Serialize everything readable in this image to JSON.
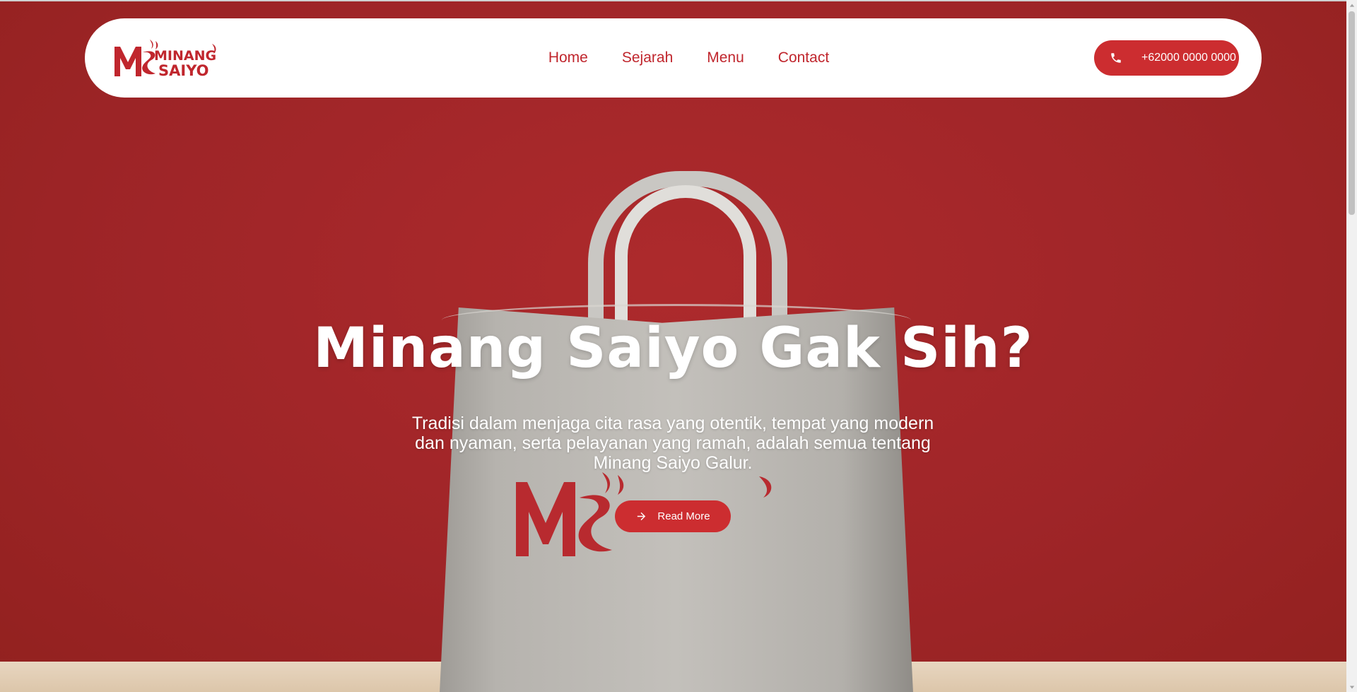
{
  "header": {
    "logo_text": "MINANG SAIYO",
    "nav": [
      {
        "label": "Home"
      },
      {
        "label": "Sejarah"
      },
      {
        "label": "Menu"
      },
      {
        "label": "Contact"
      }
    ],
    "phone_label": "+62000 0000 0000"
  },
  "hero": {
    "title": "Minang Saiyo Gak Sih?",
    "description": "Tradisi dalam menjaga cita rasa yang otentik, tempat yang modern dan nyaman, serta pelayanan yang ramah, adalah semua tentang Minang Saiyo Galur.",
    "cta_label": "Read More",
    "image_logo_text": "MINANG SAIYO"
  },
  "icons": {
    "phone": "phone-icon",
    "cta": "arrow-right-icon",
    "scroll_up": "caret-up-icon",
    "scroll_down": "caret-down-icon"
  },
  "colors": {
    "brand_red": "#cc2d30",
    "hero_background": "#a3262a",
    "navbar_background": "#ffffff",
    "text_on_red": "#ffffff"
  }
}
